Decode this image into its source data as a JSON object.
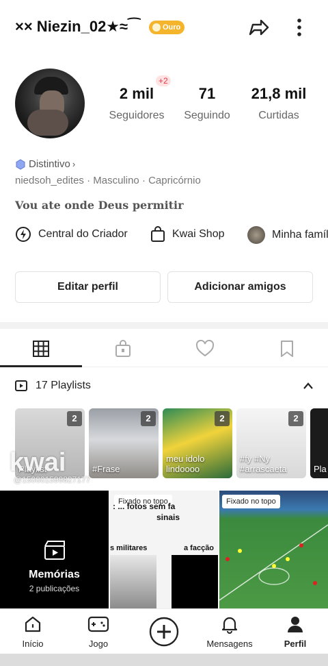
{
  "header": {
    "username": "×× Niezin_02★≈⁀",
    "badge": "Ouro"
  },
  "stats": {
    "followers_value": "2 mil",
    "followers_label": "Seguidores",
    "followers_delta": "+2",
    "following_value": "71",
    "following_label": "Seguindo",
    "likes_value": "21,8 mil",
    "likes_label": "Curtidas"
  },
  "profile": {
    "distinctive": "Distintivo",
    "meta": "niedsoh_edites · Masculino · Capricórnio",
    "bio": "Vou ate onde Deus permitir"
  },
  "shortcuts": {
    "creator": "Central do Criador",
    "shop": "Kwai Shop",
    "family": "Minha famíli"
  },
  "buttons": {
    "edit": "Editar perfil",
    "add_friends": "Adicionar amigos"
  },
  "playlists": {
    "header": "17 Playlists",
    "items": [
      {
        "name": "Playlist",
        "count": "2"
      },
      {
        "name": "#Frase",
        "count": "2"
      },
      {
        "name": "meu idolo lindoooo",
        "count": "2"
      },
      {
        "name": "#fy #Ny #arrascaeta",
        "count": "2"
      },
      {
        "name": "Pla",
        "count": ""
      }
    ]
  },
  "watermark": {
    "logo": "kwai",
    "id": "@150001599827177"
  },
  "posts": {
    "memorias_title": "Memórias",
    "memorias_count": "2 publicações",
    "pinned_label": "Fixado no topo",
    "post2_caption1": ": ... fotos sem fa",
    "post2_caption2": "sinais",
    "post2_caption3": "s militares",
    "post2_caption4": "a facção"
  },
  "nav": {
    "home": "Início",
    "game": "Jogo",
    "messages": "Mensagens",
    "profile": "Perfil"
  },
  "colors": {
    "accent": "#f4b52d",
    "plus_badge": "#e3364a"
  }
}
